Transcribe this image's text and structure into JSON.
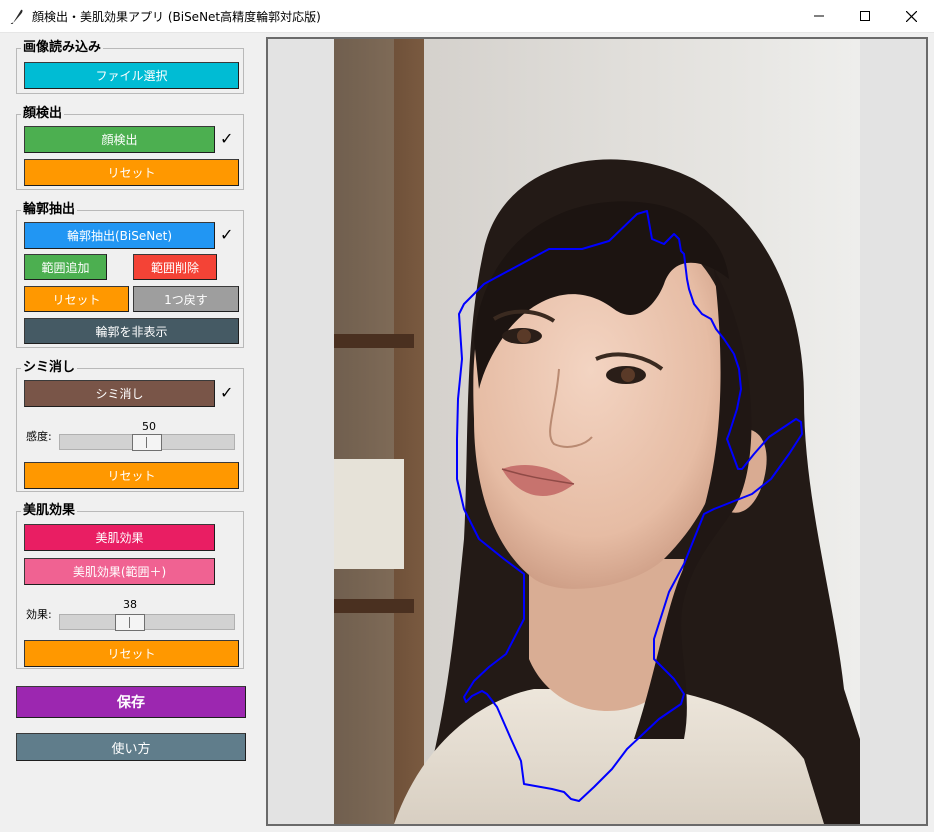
{
  "window": {
    "title": "顔検出・美肌効果アプリ (BiSeNet高精度輪郭対応版)",
    "icon": "feather-icon",
    "controls": [
      "minimize-icon",
      "maximize-icon",
      "close-icon"
    ]
  },
  "sections": {
    "load": {
      "label": "画像読み込み",
      "file_button": "ファイル選択"
    },
    "detect": {
      "label": "顔検出",
      "detect_button": "顔検出",
      "detect_check": "✓",
      "reset_button": "リセット"
    },
    "contour": {
      "label": "輪郭抽出",
      "extract_button": "輪郭抽出(BiSeNet)",
      "extract_check": "✓",
      "add_range_button": "範囲追加",
      "delete_range_button": "範囲削除",
      "reset_button": "リセット",
      "undo_button": "1つ戻す",
      "hide_button": "輪郭を非表示"
    },
    "spot": {
      "label": "シミ消し",
      "spot_button": "シミ消し",
      "spot_check": "✓",
      "sensitivity_label": "感度:",
      "sensitivity_value": "50",
      "reset_button": "リセット"
    },
    "beauty": {
      "label": "美肌効果",
      "beauty_button": "美肌効果",
      "beauty_range_button": "美肌効果(範囲＋)",
      "effect_label": "効果:",
      "effect_value": "38",
      "reset_button": "リセット"
    }
  },
  "save_button": "保存",
  "help_button": "使い方",
  "sliders": {
    "sensitivity_fraction": 0.5,
    "effect_fraction": 0.38
  },
  "colors": {
    "cyan": "#00bcd4",
    "green": "#4caf50",
    "orange": "#ff9800",
    "blue": "#2196f3",
    "red": "#f44336",
    "gray": "#9e9e9e",
    "slate": "#455a64",
    "brown": "#795548",
    "pink": "#e91e63",
    "light_pink": "#f06292",
    "purple": "#9c27b0",
    "blue_gray": "#607d8b",
    "contour": "#0000ff"
  }
}
